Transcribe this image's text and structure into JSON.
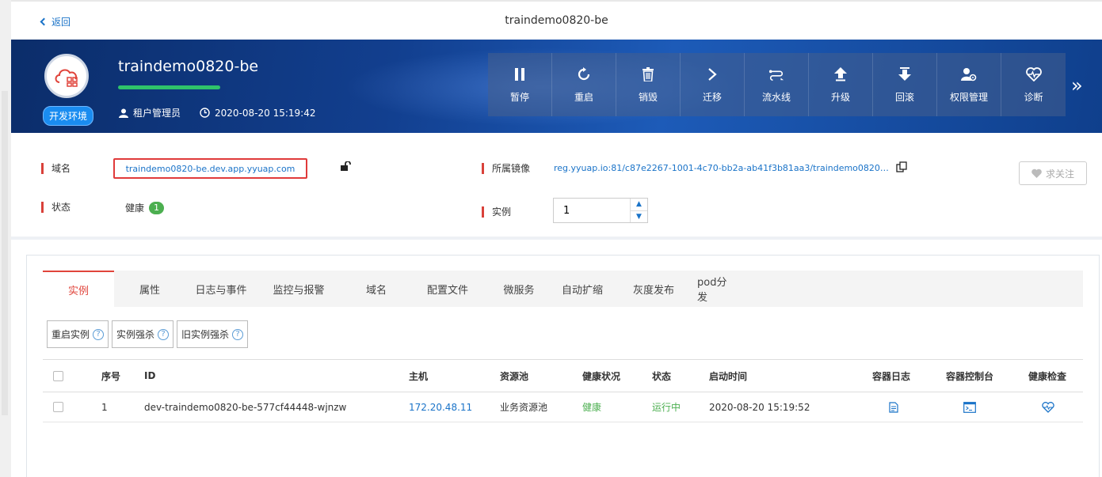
{
  "header": {
    "back_label": "返回",
    "title": "traindemo0820-be"
  },
  "app": {
    "name": "traindemo0820-be",
    "env_badge": "开发环境",
    "owner": "租户管理员",
    "created": "2020-08-20 15:19:42"
  },
  "toolbar": [
    {
      "label": "暂停",
      "icon": "pause-icon"
    },
    {
      "label": "重启",
      "icon": "restart-icon"
    },
    {
      "label": "销毁",
      "icon": "trash-icon"
    },
    {
      "label": "迁移",
      "icon": "chevron-right-icon"
    },
    {
      "label": "流水线",
      "icon": "pipeline-icon"
    },
    {
      "label": "升级",
      "icon": "upgrade-icon"
    },
    {
      "label": "回滚",
      "icon": "rollback-icon"
    },
    {
      "label": "权限管理",
      "icon": "permission-icon"
    },
    {
      "label": "诊断",
      "icon": "diagnose-icon"
    }
  ],
  "info": {
    "domain_label": "域名",
    "domain_value": "traindemo0820-be.dev.app.yyuap.com",
    "status_label": "状态",
    "status_value": "健康",
    "status_count": "1",
    "image_label": "所属镜像",
    "image_value": "reg.yyuap.io:81/c87e2267-1001-4c70-bb2a-ab41f3b81aa3/traindemo0820-be:...",
    "instance_label": "实例",
    "instance_value": "1",
    "follow_label": "求关注"
  },
  "tabs": [
    "实例",
    "属性",
    "日志与事件",
    "监控与报警",
    "域名",
    "配置文件",
    "微服务",
    "自动扩缩",
    "灰度发布",
    "pod分发"
  ],
  "actions": [
    "重启实例",
    "实例强杀",
    "旧实例强杀"
  ],
  "table": {
    "headers": [
      "序号",
      "ID",
      "主机",
      "资源池",
      "健康状况",
      "状态",
      "启动时间",
      "容器日志",
      "容器控制台",
      "健康检查"
    ],
    "rows": [
      {
        "index": "1",
        "id": "dev-traindemo0820-be-577cf44448-wjnzw",
        "host": "172.20.48.11",
        "pool": "业务资源池",
        "health": "健康",
        "status": "运行中",
        "started": "2020-08-20 15:19:52"
      }
    ]
  },
  "colors": {
    "accent": "#e0443b",
    "link": "#1a73c8",
    "healthy": "#4caf50",
    "banner": "#123f8f"
  }
}
